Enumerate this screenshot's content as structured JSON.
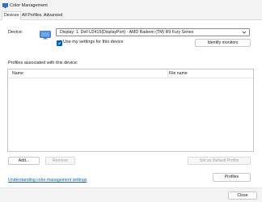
{
  "window": {
    "title": "Color Management",
    "icon": "color-management-icon"
  },
  "tabs": [
    {
      "label": "Devices",
      "active": true
    },
    {
      "label": "All Profiles",
      "active": false
    },
    {
      "label": "Advanced",
      "active": false
    }
  ],
  "device": {
    "label": "Device:",
    "selected": "Display: 1. Dell U2415(DisplayPort) - AMD Radeon (TM) R9 Fury Series",
    "use_settings_label": "Use my settings for this device",
    "use_settings_checked": true,
    "identify_label": "Identify monitors"
  },
  "profiles": {
    "section_label": "Profiles associated with this device:",
    "columns": [
      "Name",
      "File name"
    ],
    "rows": []
  },
  "actions": {
    "add_label": "Add...",
    "remove_label": "Remove",
    "set_default_label": "Set as Default Profile",
    "profiles_label": "Profiles"
  },
  "footer": {
    "link_text": "Understanding color management settings",
    "close_label": "Close"
  },
  "colors": {
    "accent": "#005fb8",
    "link": "#0b5fb8"
  }
}
